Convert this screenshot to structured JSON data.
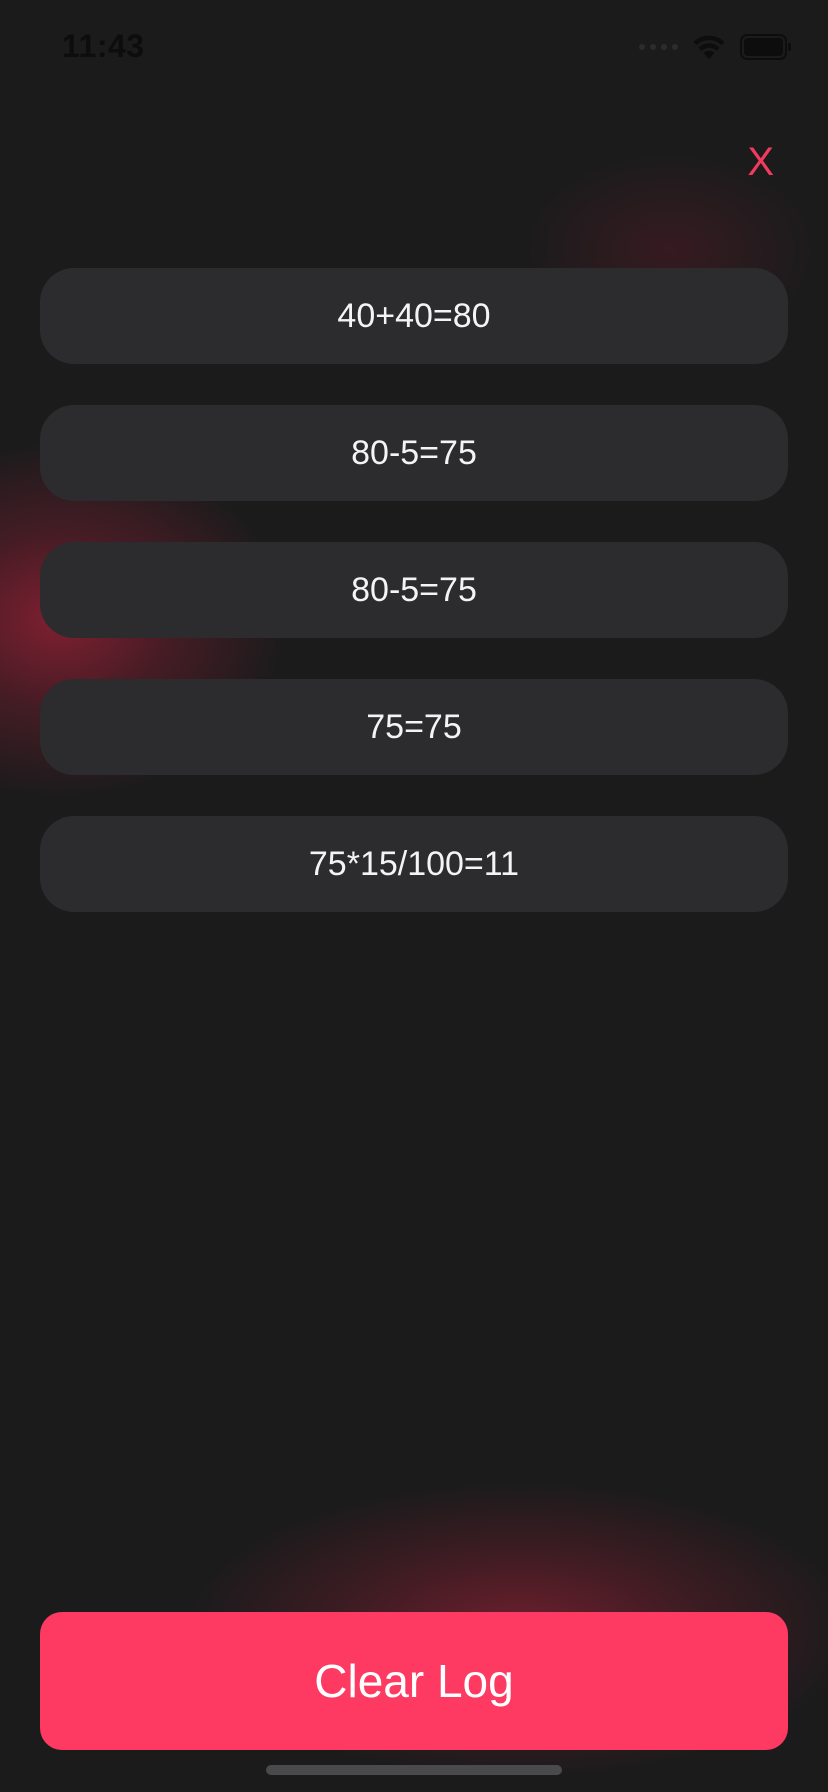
{
  "status_bar": {
    "time": "11:43"
  },
  "header": {
    "close_label": "X"
  },
  "log": {
    "entries": [
      "40+40=80",
      "80-5=75",
      "80-5=75",
      "75=75",
      "75*15/100=11"
    ]
  },
  "actions": {
    "clear_label": "Clear Log"
  },
  "colors": {
    "background": "#1b1b1c",
    "accent": "#fe3a62",
    "card": "#2c2c2e",
    "text": "#f4f4f4"
  },
  "icons": {
    "signal": "cellular-signal-icon",
    "wifi": "wifi-icon",
    "battery": "battery-icon"
  }
}
